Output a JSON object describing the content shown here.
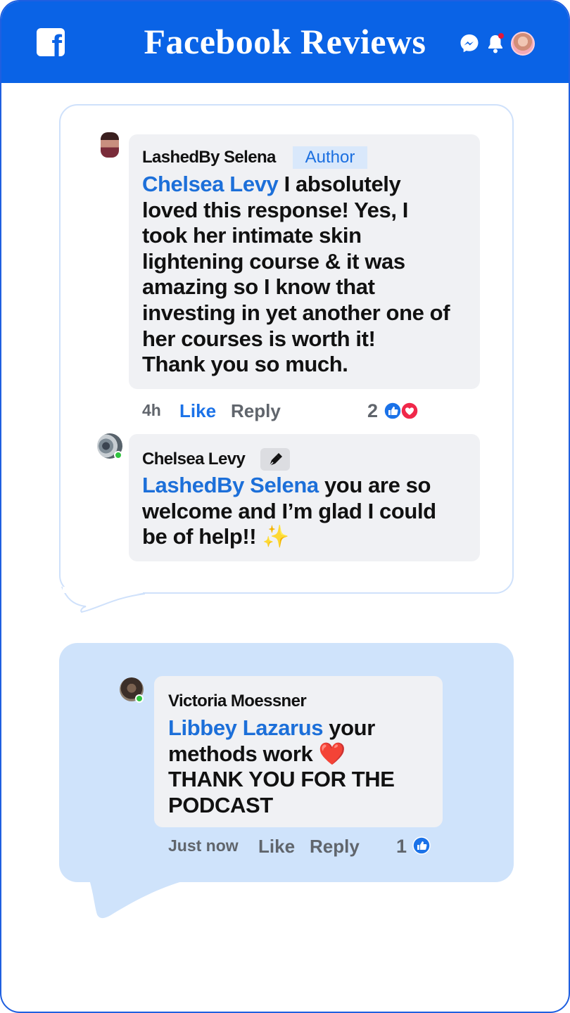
{
  "header": {
    "title": "Facebook Reviews",
    "logo_letter": "f"
  },
  "colors": {
    "brand": "#0a63e6",
    "mention": "#1c6fd9",
    "bubble_bg": "#f0f1f4",
    "card2_bg": "#cfe3fb",
    "like_blue": "#1b72e8",
    "love_red": "#f0284a",
    "online_green": "#31c440"
  },
  "review1": {
    "comment": {
      "author": "LashedBy Selena",
      "badge": "Author",
      "mention": "Chelsea Levy",
      "lines": [
        " I absolutely",
        "loved this response! Yes, I",
        "took her intimate skin",
        "lightening course & it was",
        "amazing so I know that",
        "investing in yet another one of",
        "her courses is worth it!",
        "Thank you so much."
      ],
      "time": "4h",
      "like_label": "Like",
      "reply_label": "Reply",
      "reaction_count": "2",
      "reactions": [
        "like-icon",
        "love-icon"
      ]
    },
    "reply": {
      "author": "Chelsea Levy",
      "badge_icon": "pen-icon",
      "mention": "LashedBy Selena",
      "lines": [
        " you are so",
        "welcome and I’m glad I could",
        "be of help!! ✨"
      ]
    }
  },
  "review2": {
    "comment": {
      "author": "Victoria Moessner",
      "mention": "Libbey Lazarus",
      "lines": [
        " your",
        "methods work ❤️",
        "THANK YOU FOR THE",
        "PODCAST"
      ],
      "time": "Just now",
      "like_label": "Like",
      "reply_label": "Reply",
      "reaction_count": "1",
      "reactions": [
        "like-icon"
      ]
    }
  }
}
